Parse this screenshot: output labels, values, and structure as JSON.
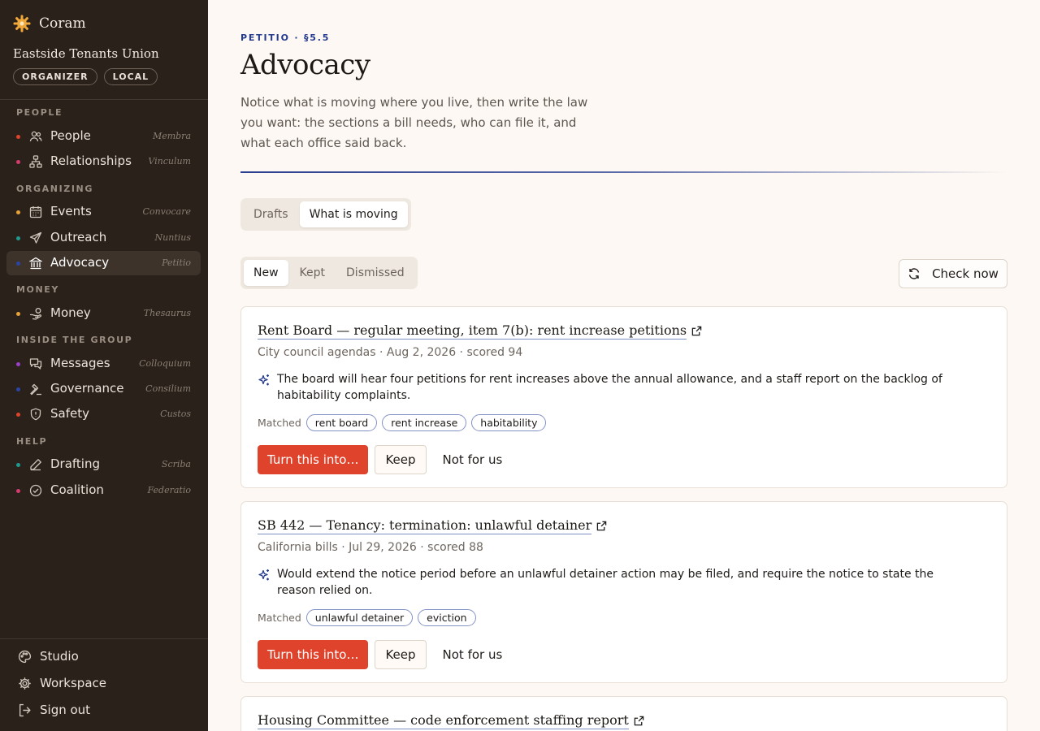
{
  "app": {
    "name": "Coram",
    "logo_icon": "sun-gear-icon"
  },
  "workspace": {
    "org_name": "Eastside Tenants Union",
    "badges": [
      "ORGANIZER",
      "LOCAL"
    ]
  },
  "sidebar": {
    "sections": [
      {
        "label": "PEOPLE",
        "items": [
          {
            "label": "People",
            "latin": "Membra",
            "dot": "#e0432b",
            "icon": "people-icon"
          },
          {
            "label": "Relationships",
            "latin": "Vinculum",
            "dot": "#d63b6f",
            "icon": "network-icon"
          }
        ]
      },
      {
        "label": "ORGANIZING",
        "items": [
          {
            "label": "Events",
            "latin": "Convocare",
            "dot": "#e8a23a",
            "icon": "calendar-icon"
          },
          {
            "label": "Outreach",
            "latin": "Nuntius",
            "dot": "#1f9a8f",
            "icon": "send-icon"
          },
          {
            "label": "Advocacy",
            "latin": "Petitio",
            "dot": "#2b44a8",
            "icon": "bank-icon",
            "active": true
          }
        ]
      },
      {
        "label": "MONEY",
        "items": [
          {
            "label": "Money",
            "latin": "Thesaurus",
            "dot": "#e8a23a",
            "icon": "hand-coins-icon"
          }
        ]
      },
      {
        "label": "INSIDE THE GROUP",
        "items": [
          {
            "label": "Messages",
            "latin": "Colloquium",
            "dot": "#9a3fc9",
            "icon": "messages-icon"
          },
          {
            "label": "Governance",
            "latin": "Consilium",
            "dot": "#2b44a8",
            "icon": "gavel-icon"
          },
          {
            "label": "Safety",
            "latin": "Custos",
            "dot": "#e0432b",
            "icon": "shield-icon"
          }
        ]
      },
      {
        "label": "HELP",
        "items": [
          {
            "label": "Drafting",
            "latin": "Scriba",
            "dot": "#1f9a8f",
            "icon": "pen-icon"
          },
          {
            "label": "Coalition",
            "latin": "Federatio",
            "dot": "#d63b6f",
            "icon": "check-circle-icon"
          }
        ]
      }
    ],
    "footer": [
      {
        "label": "Studio",
        "icon": "palette-icon"
      },
      {
        "label": "Workspace",
        "icon": "gear-icon"
      },
      {
        "label": "Sign out",
        "icon": "sign-out-icon"
      }
    ]
  },
  "main": {
    "eyebrow": "PETITIO · §5.5",
    "title": "Advocacy",
    "intro": "Notice what is moving where you live, then write the law you want: the sections a bill needs, who can file it, and what each office said back.",
    "view_tabs": [
      {
        "label": "Drafts",
        "active": false
      },
      {
        "label": "What is moving",
        "active": true
      }
    ],
    "filter_tabs": [
      {
        "label": "New",
        "active": true
      },
      {
        "label": "Kept",
        "active": false
      },
      {
        "label": "Dismissed",
        "active": false
      }
    ],
    "check_now_label": "Check now",
    "matched_label": "Matched",
    "actions": {
      "primary": "Turn this into…",
      "keep": "Keep",
      "dismiss": "Not for us"
    },
    "items": [
      {
        "title": "Rent Board — regular meeting, item 7(b): rent increase petitions",
        "meta": "City council agendas · Aug 2, 2026 · scored 94",
        "summary": "The board will hear four petitions for rent increases above the annual allowance, and a staff report on the backlog of habitability complaints.",
        "tags": [
          "rent board",
          "rent increase",
          "habitability"
        ]
      },
      {
        "title": "SB 442 — Tenancy: termination: unlawful detainer",
        "meta": "California bills · Jul 29, 2026 · scored 88",
        "summary": "Would extend the notice period before an unlawful detainer action may be filed, and require the notice to state the reason relied on.",
        "tags": [
          "unlawful detainer",
          "eviction"
        ]
      },
      {
        "title": "Housing Committee — code enforcement staffing report"
      }
    ]
  }
}
